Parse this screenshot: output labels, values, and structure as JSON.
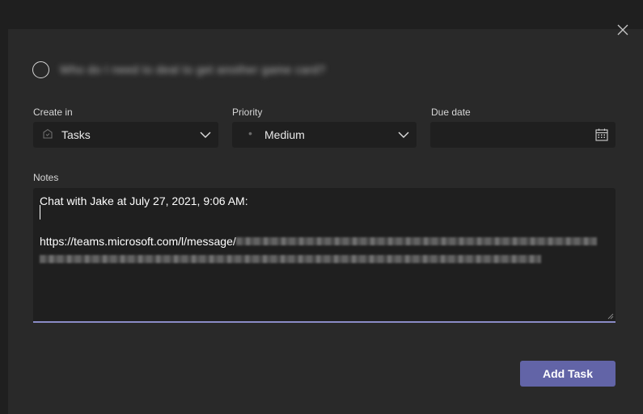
{
  "dialog": {
    "title_blurred": "Who do I need to deal to get another game card?"
  },
  "fields": {
    "create_in": {
      "label": "Create in",
      "value": "Tasks",
      "icon": "planner-icon"
    },
    "priority": {
      "label": "Priority",
      "value": "Medium",
      "bullet": "•"
    },
    "due_date": {
      "label": "Due date",
      "value": "",
      "icon": "calendar-icon"
    }
  },
  "notes": {
    "label": "Notes",
    "line1": "Chat with Jake at July 27, 2021, 9:06 AM:",
    "url_prefix": "https://teams.microsoft.com/l/message/"
  },
  "actions": {
    "add_task_label": "Add Task"
  },
  "colors": {
    "accent": "#6264a7",
    "focus_underline": "#8b8cc7",
    "dialog_bg": "#292929",
    "input_bg": "#1f1f1f"
  }
}
